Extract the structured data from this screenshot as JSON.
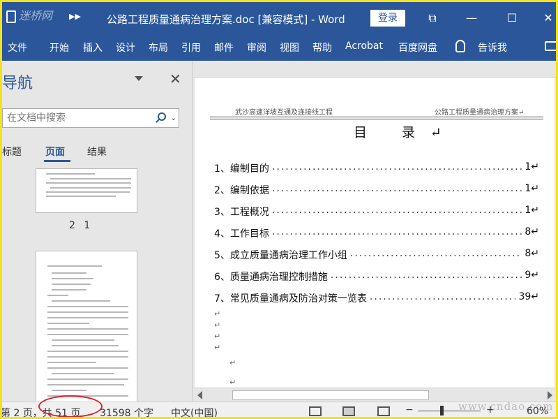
{
  "titlebar": {
    "logo": "迷桥网",
    "title": "公路工程质量通病治理方案.doc [兼容模式] - Word",
    "login": "登录",
    "colors": {
      "bar": "#2b579a"
    }
  },
  "ribbon": {
    "tabs": [
      "文件",
      "开始",
      "插入",
      "设计",
      "布局",
      "引用",
      "邮件",
      "审阅",
      "视图",
      "帮助",
      "Acrobat",
      "百度网盘",
      "告诉我"
    ]
  },
  "nav": {
    "title": "导航",
    "search_placeholder": "在文档中搜索",
    "tabs": [
      "标题",
      "页面",
      "结果"
    ],
    "active_tab": "页面",
    "thumb_label": "2 1"
  },
  "document": {
    "header_left": "武沙高速洋坡互通及连接线工程",
    "header_right": "公路工程质量通病治理方案↵",
    "toc_heading": "目  录↵",
    "toc": [
      {
        "text": "1、编制目的",
        "page": "1↵"
      },
      {
        "text": "2、编制依据",
        "page": "1↵"
      },
      {
        "text": "3、工程概况",
        "page": "1↵"
      },
      {
        "text": "4、工作目标",
        "page": "8↵"
      },
      {
        "text": "5、成立质量通病治理工作小组",
        "page": "8↵"
      },
      {
        "text": "6、质量通病治理控制措施",
        "page": "9↵"
      },
      {
        "text": "7、常见质量通病及防治对策一览表",
        "page": "39↵"
      }
    ],
    "para_mark": "↵"
  },
  "status": {
    "page": "第 2 页，共 51 页",
    "words": "31598 个字",
    "language": "中文(中国)",
    "zoom": "60%",
    "watermark": "www.cndao.com"
  }
}
